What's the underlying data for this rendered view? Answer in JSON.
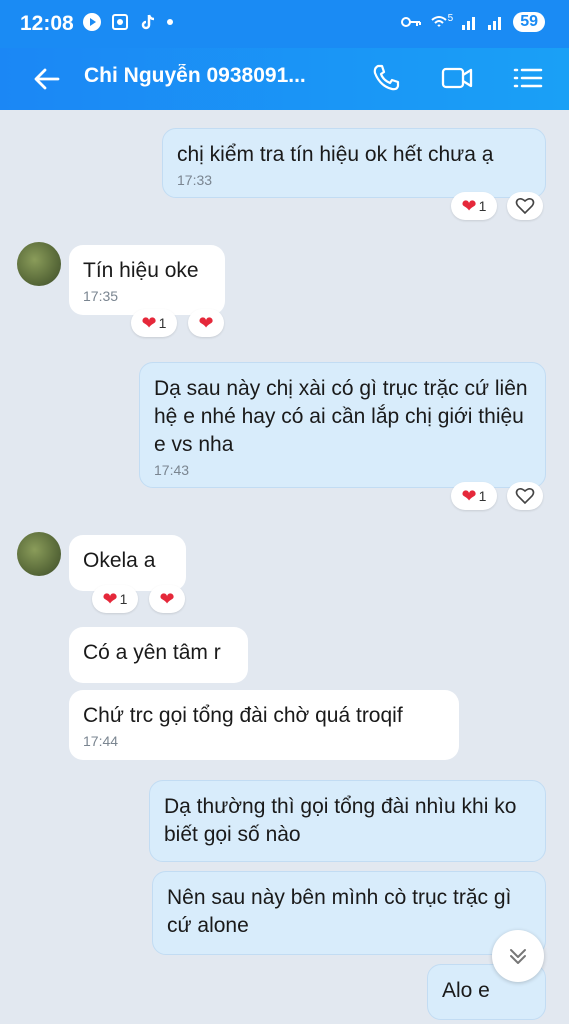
{
  "status": {
    "time": "12:08",
    "battery": "59",
    "wifi_label": "5"
  },
  "header": {
    "contact": "Chi Nguyễn 0938091..."
  },
  "messages": [
    {
      "text": "chị kiểm tra tín hiệu ok hết chưa ạ",
      "time": "17:33",
      "react_count": "1"
    },
    {
      "text": "Tín hiệu oke",
      "time": "17:35",
      "react_count": "1"
    },
    {
      "text": "Dạ sau này chị xài có gì trục trặc cứ liên hệ e nhé hay có ai cần lắp chị giới thiệu e vs nha",
      "time": "17:43",
      "react_count": "1"
    },
    {
      "text": "Okela a",
      "react_count": "1"
    },
    {
      "text": "Có a yên tâm r"
    },
    {
      "text": "Chứ trc gọi tổng đài chờ quá troqif",
      "time": "17:44"
    },
    {
      "text": "Dạ thường thì gọi tổng đài nhìu khi ko biết gọi số nào"
    },
    {
      "text": "Nên sau này bên mình cò trục trặc gì cứ alone"
    },
    {
      "text": "Alo e"
    }
  ]
}
